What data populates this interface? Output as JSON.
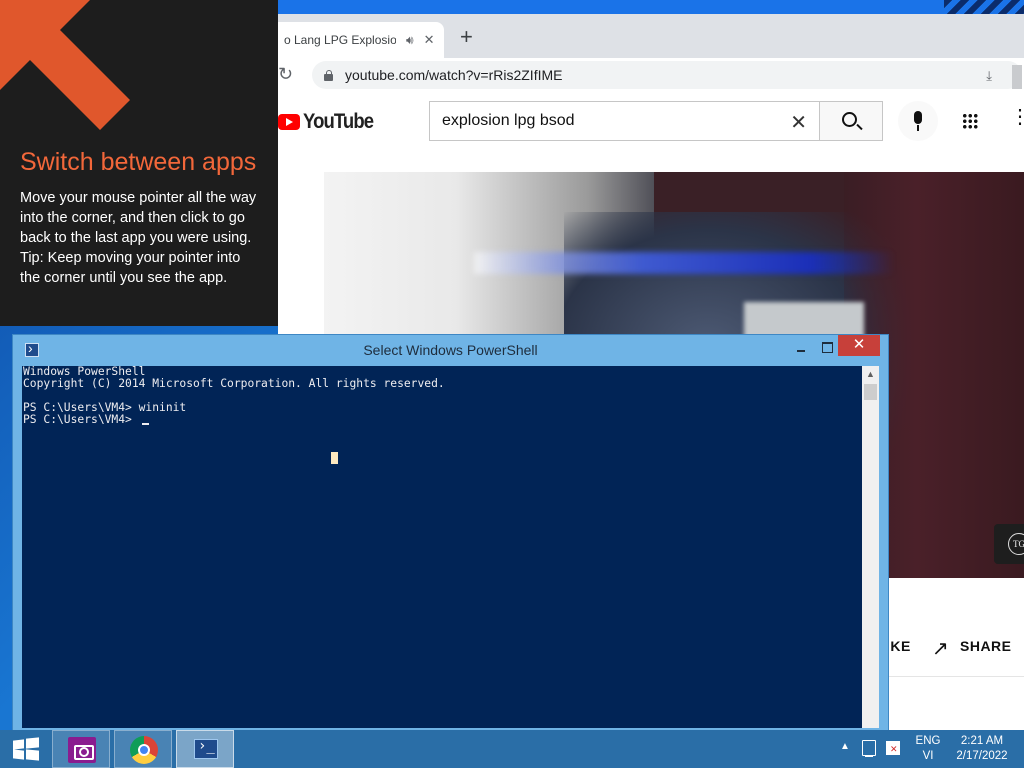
{
  "chrome": {
    "tab_title": "o Lang LPG Explosion",
    "tab_audio_icon": "speaker-icon",
    "tab_close": "✕",
    "new_tab": "+",
    "url": "youtube.com/watch?v=rRis2ZIfIME"
  },
  "youtube": {
    "logo_text": "YouTube",
    "search_value": "explosion lpg bsod",
    "search_clear": "✕",
    "more": "⋮",
    "like_label": "IKE",
    "share_icon": "↗",
    "share_label": "SHARE",
    "watermark": "TG"
  },
  "hint": {
    "title": "Switch between apps",
    "body_line1": "Move your mouse pointer all the way into the corner, and then click to go back to the last app you were using.",
    "body_line2": "Tip: Keep moving your pointer into the corner until you see the app.",
    "accent": "#f2673a"
  },
  "powershell": {
    "title": "Select Windows PowerShell",
    "close": "✕",
    "scroll_up": "▲",
    "console_text": "Windows PowerShell\nCopyright (C) 2014 Microsoft Corporation. All rights reserved.\n\nPS C:\\Users\\VM4> wininit\nPS C:\\Users\\VM4> ",
    "background": "#012456"
  },
  "taskbar": {
    "apps": [
      "camera-app",
      "google-chrome",
      "windows-powershell"
    ],
    "tray_arrow": "▲",
    "lang_line1": "ENG",
    "lang_line2": "VI",
    "time": "2:21 AM",
    "date": "2/17/2022"
  }
}
